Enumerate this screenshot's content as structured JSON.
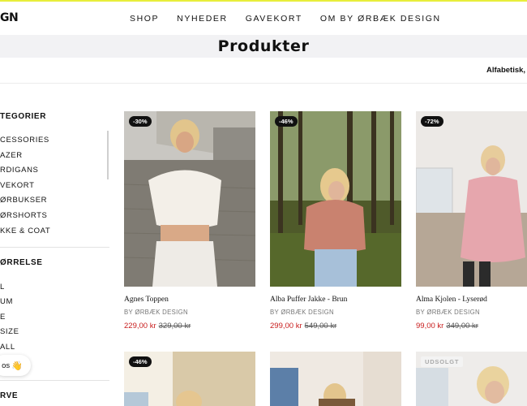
{
  "header": {
    "logo": "GN",
    "nav": [
      "SHOP",
      "NYHEDER",
      "GAVEKORT",
      "OM BY ØRBÆK DESIGN"
    ]
  },
  "page": {
    "title": "Produkter",
    "sort_label": "Alfabetisk, A"
  },
  "sidebar": {
    "categories_heading": "TEGORIER",
    "categories": [
      "CESSORIES",
      "AZER",
      "RDIGANS",
      "VEKORT",
      "ØRBUKSER",
      "ØRSHORTS",
      "KKE & COAT"
    ],
    "size_heading": "ØRRELSE",
    "sizes": [
      "L",
      "UM",
      "E",
      "SIZE",
      "ALL"
    ],
    "color_heading": "RVE"
  },
  "chat": {
    "label": "os",
    "icon": "waving-hand-icon"
  },
  "colors": {
    "accent_line": "#e8ee3b",
    "sale_price": "#c81d1d",
    "badge_bg": "#111111"
  },
  "products": [
    {
      "badge": "-30%",
      "name": "Agnes Toppen",
      "brand": "BY ØRBÆK DESIGN",
      "price": "229,00 kr",
      "old_price": "329,00 kr"
    },
    {
      "badge": "-46%",
      "name": "Alba Puffer Jakke - Brun",
      "brand": "BY ØRBÆK DESIGN",
      "price": "299,00 kr",
      "old_price": "549,00 kr"
    },
    {
      "badge": "-72%",
      "name": "Alma Kjolen - Lyserød",
      "brand": "BY ØRBÆK DESIGN",
      "price": "99,00 kr",
      "old_price": "349,00 kr"
    }
  ],
  "products_row2": [
    {
      "badge": "-46%"
    },
    {
      "badge": ""
    },
    {
      "badge": "UDSOLGT"
    }
  ]
}
